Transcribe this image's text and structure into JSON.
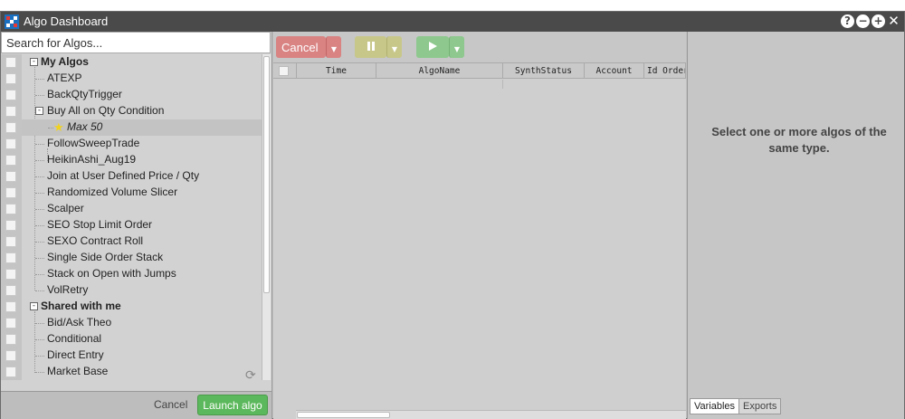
{
  "window": {
    "title": "Algo Dashboard",
    "controls": [
      "?",
      "−",
      "+",
      "✕"
    ]
  },
  "search": {
    "placeholder": "Search for Algos..."
  },
  "tree": {
    "my_algos": {
      "label": "My Algos",
      "items": [
        "ATEXP",
        "BackQtyTrigger",
        {
          "label": "Buy All on Qty Condition",
          "children": [
            "Max 50"
          ]
        },
        "FollowSweepTrade",
        "HeikinAshi_Aug19",
        "Join at User Defined Price / Qty",
        "Randomized Volume Slicer",
        "Scalper",
        "SEO Stop Limit Order",
        "SEXO Contract Roll",
        "Single Side Order Stack",
        "Stack on Open with Jumps",
        "VolRetry"
      ]
    },
    "shared": {
      "label": "Shared with me",
      "items": [
        "Bid/Ask Theo",
        "Conditional",
        "Direct Entry",
        "Market Base"
      ]
    },
    "labels": {
      "my_algos": "My Algos",
      "atexp": "ATEXP",
      "backqty": "BackQtyTrigger",
      "buyall": "Buy All on Qty Condition",
      "max50": "Max 50",
      "follow": "FollowSweepTrade",
      "heikin": "HeikinAshi_Aug19",
      "join": "Join at User Defined Price / Qty",
      "randomized": "Randomized Volume Slicer",
      "scalper": "Scalper",
      "seo": "SEO Stop Limit Order",
      "sexo": "SEXO Contract Roll",
      "single": "Single Side Order Stack",
      "stack": "Stack on Open with Jumps",
      "volretry": "VolRetry",
      "shared": "Shared with me",
      "bidask": "Bid/Ask Theo",
      "conditional": "Conditional",
      "direct": "Direct Entry",
      "market": "Market Base"
    }
  },
  "footer": {
    "cancel_label": "Cancel",
    "launch_label": "Launch algo"
  },
  "toolbar": {
    "cancel_label": "Cancel",
    "pause_icon": "pause-icon",
    "play_icon": "play-icon"
  },
  "grid": {
    "columns": [
      "Time",
      "AlgoName",
      "SynthStatus",
      "Account",
      "Id Order"
    ]
  },
  "right_panel": {
    "message": "Select one or more algos of the same type.",
    "tabs": [
      "Variables",
      "Exports"
    ]
  },
  "colors": {
    "titlebar": "#4a4a4a",
    "launch_button": "#5cb85c",
    "cancel_button": "#d98383",
    "pause_button": "#c7c78a",
    "play_button": "#8ec88e",
    "favorite_star": "#f1d21e"
  }
}
